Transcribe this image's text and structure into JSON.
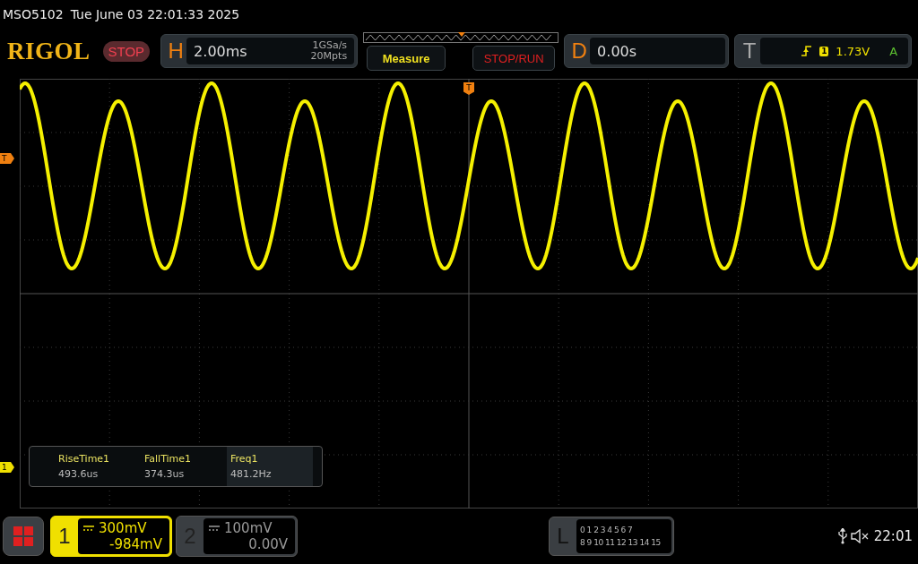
{
  "status_line": {
    "model": "MSO5102",
    "datetime": "Tue June 03 22:01:33 2025"
  },
  "header": {
    "logo": "RIGOL",
    "run_state": "STOP",
    "horizontal": {
      "label": "H",
      "timebase": "2.00ms",
      "sample_rate": "1GSa/s",
      "memory_depth": "20Mpts"
    },
    "buttons": [
      {
        "label": "Measure",
        "kind": "measure"
      },
      {
        "label": "STOP/RUN",
        "kind": "run"
      }
    ],
    "delay": {
      "label": "D",
      "value": "0.00s"
    },
    "trigger": {
      "label": "T",
      "source": "1",
      "level": "1.73V",
      "mode": "A"
    }
  },
  "display": {
    "trigger_position_marker": "T",
    "trigger_level_marker": "T",
    "channel_marker": "1",
    "measurements": [
      {
        "name": "RiseTime1",
        "value": "493.6us",
        "selected": false
      },
      {
        "name": "FallTime1",
        "value": "374.3us",
        "selected": false
      },
      {
        "name": "Freq1",
        "value": "481.2Hz",
        "selected": true
      }
    ]
  },
  "bottom": {
    "channels": [
      {
        "number": "1",
        "scale": "300mV",
        "offset": "-984mV",
        "active": true
      },
      {
        "number": "2",
        "scale": "100mV",
        "offset": "0.00V",
        "active": false
      }
    ],
    "logic": {
      "label": "L",
      "rows": [
        "0 1 2 3 4 5 6 7",
        "8 9 10 11 12 13 14 15"
      ]
    },
    "clock": "22:01"
  }
}
